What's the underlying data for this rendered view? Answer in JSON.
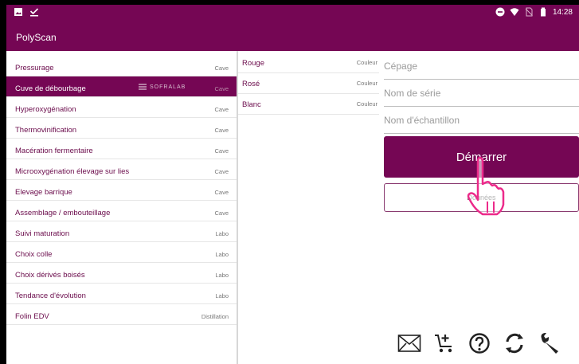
{
  "statusbar": {
    "time": "14:28",
    "icons": [
      "image-icon",
      "check-download-icon",
      "dnd-icon",
      "wifi-icon",
      "no-sim-icon",
      "battery-icon"
    ]
  },
  "appbar": {
    "title": "PolyScan"
  },
  "processes": [
    {
      "label": "Pressurage",
      "tag": "Cave"
    },
    {
      "label": "Cuve de débourbage",
      "tag": "Cave",
      "selected": true
    },
    {
      "label": "Hyperoxygénation",
      "tag": "Cave"
    },
    {
      "label": "Thermovinification",
      "tag": "Cave"
    },
    {
      "label": "Macération fermentaire",
      "tag": "Cave"
    },
    {
      "label": "Microoxygénation élevage sur lies",
      "tag": "Cave"
    },
    {
      "label": "Elevage barrique",
      "tag": "Cave"
    },
    {
      "label": "Assemblage / embouteillage",
      "tag": "Cave"
    },
    {
      "label": "Suivi maturation",
      "tag": "Labo"
    },
    {
      "label": "Choix colle",
      "tag": "Labo"
    },
    {
      "label": "Choix dérivés boisés",
      "tag": "Labo"
    },
    {
      "label": "Tendance d'évolution",
      "tag": "Labo"
    },
    {
      "label": "Folin EDV",
      "tag": "Distillation"
    }
  ],
  "watermark": "SOFRALAB",
  "colors_list": [
    {
      "label": "Rouge",
      "tag": "Couleur"
    },
    {
      "label": "Rosé",
      "tag": "Couleur"
    },
    {
      "label": "Blanc",
      "tag": "Couleur"
    }
  ],
  "form": {
    "cepage_placeholder": "Cépage",
    "serie_placeholder": "Nom de série",
    "echantillon_placeholder": "Nom d'échantillon"
  },
  "buttons": {
    "start": "Démarrer",
    "data": "Données"
  },
  "toolbar": [
    "mail-icon",
    "cart-add-icon",
    "help-icon",
    "sync-icon",
    "wrench-icon"
  ],
  "theme": {
    "primary": "#750654",
    "text_accent": "#6b0c4c"
  }
}
